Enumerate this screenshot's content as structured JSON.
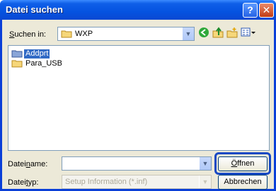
{
  "window": {
    "title": "Datei suchen",
    "help_button": "?",
    "close_button": "✕"
  },
  "lookin": {
    "label_accel": "S",
    "label_rest": "uchen in:",
    "value": "WXP"
  },
  "files": [
    {
      "name": "Addprt",
      "selected": true
    },
    {
      "name": "Para_USB",
      "selected": false
    }
  ],
  "filename": {
    "label_pre": "Datei",
    "label_accel": "n",
    "label_post": "ame:",
    "value": ""
  },
  "filetype": {
    "label_pre": "Datei",
    "label_accel": "t",
    "label_post": "yp:",
    "value": "Setup Information (*.inf)"
  },
  "buttons": {
    "open_accel": "Ö",
    "open_rest": "ffnen",
    "cancel": "Abbrechen"
  },
  "icons": {
    "back": "back-arrow-icon",
    "up": "up-folder-icon",
    "new_folder": "new-folder-icon",
    "view_menu": "view-menu-icon"
  },
  "colors": {
    "titlebar": "#0553e0",
    "client": "#ece9d8",
    "selection": "#316ac5",
    "highlight": "#1749c4"
  }
}
